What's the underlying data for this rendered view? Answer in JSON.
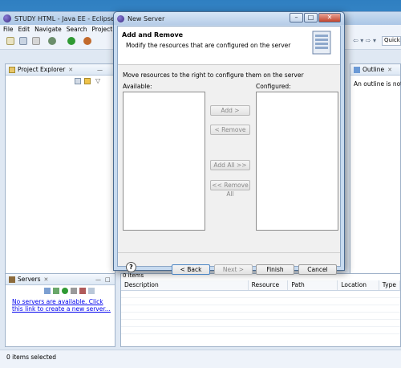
{
  "eclipse": {
    "title": "STUDY HTML - Java EE - Eclipse",
    "menu": [
      "File",
      "Edit",
      "Navigate",
      "Search",
      "Project"
    ],
    "quick_access": "Quick A"
  },
  "project_explorer": {
    "tab_label": "Project Explorer",
    "close": "✕"
  },
  "outline": {
    "tab_label": "Outline",
    "close": "✕",
    "message": "An outline is not av"
  },
  "servers": {
    "tab_label": "Servers",
    "close": "✕",
    "link_text": "No servers are available. Click this link to create a new server..."
  },
  "problems": {
    "items_label": "0 items",
    "columns": [
      "Description",
      "Resource",
      "Path",
      "Location",
      "Type"
    ]
  },
  "status_bar": {
    "text": "0 items selected"
  },
  "dialog": {
    "title": "New Server",
    "heading": "Add and Remove",
    "description": "Modify the resources that are configured on the server",
    "instruction": "Move resources to the right to configure them on the server",
    "available_label": "Available:",
    "configured_label": "Configured:",
    "add_label": "Add >",
    "remove_label": "< Remove",
    "add_all_label": "Add All >>",
    "remove_all_label": "<< Remove All",
    "help_label": "?",
    "back_label": "< Back",
    "next_label": "Next >",
    "finish_label": "Finish",
    "cancel_label": "Cancel",
    "minimize": "–",
    "maximize": "□",
    "close": "✕"
  }
}
